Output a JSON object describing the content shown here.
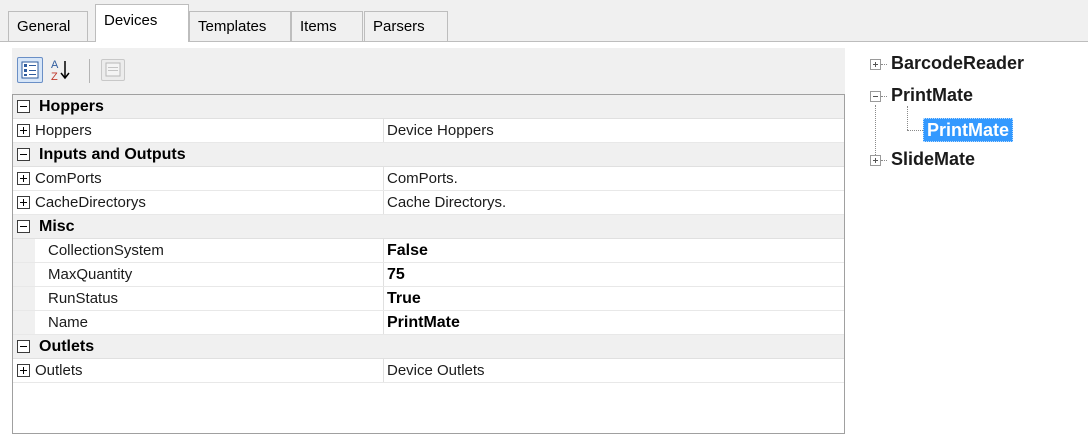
{
  "tabs": [
    "General",
    "Devices",
    "Templates",
    "Items",
    "Parsers"
  ],
  "active_tab": "Devices",
  "toolbar": {
    "categorized_icon": "categorized-icon",
    "alphabetical_icon": "alphabetical-sort-icon",
    "alphabetical_glyph": "A Z",
    "property_pages_icon": "property-pages-icon"
  },
  "property_grid": {
    "categories": [
      {
        "name": "Hoppers",
        "rows": [
          {
            "name": "Hoppers",
            "value": "Device Hoppers",
            "expandable": true
          }
        ]
      },
      {
        "name": "Inputs and Outputs",
        "rows": [
          {
            "name": "ComPorts",
            "value": "ComPorts.",
            "expandable": true
          },
          {
            "name": "CacheDirectorys",
            "value": "Cache Directorys.",
            "expandable": true
          }
        ]
      },
      {
        "name": "Misc",
        "rows": [
          {
            "name": "CollectionSystem",
            "value": "False",
            "expandable": false
          },
          {
            "name": "MaxQuantity",
            "value": "75",
            "expandable": false
          },
          {
            "name": "RunStatus",
            "value": "True",
            "expandable": false
          },
          {
            "name": "Name",
            "value": "PrintMate",
            "expandable": false
          }
        ]
      },
      {
        "name": "Outlets",
        "rows": [
          {
            "name": "Outlets",
            "value": "Device Outlets",
            "expandable": true
          }
        ]
      }
    ]
  },
  "tree": {
    "nodes": [
      {
        "label": "BarcodeReader",
        "expanded": false
      },
      {
        "label": "PrintMate",
        "expanded": true,
        "children": [
          {
            "label": "PrintMate",
            "selected": true
          }
        ]
      },
      {
        "label": "SlideMate",
        "expanded": false
      }
    ]
  },
  "colors": {
    "selection": "#3399ff",
    "background": "#f0f0f0"
  }
}
